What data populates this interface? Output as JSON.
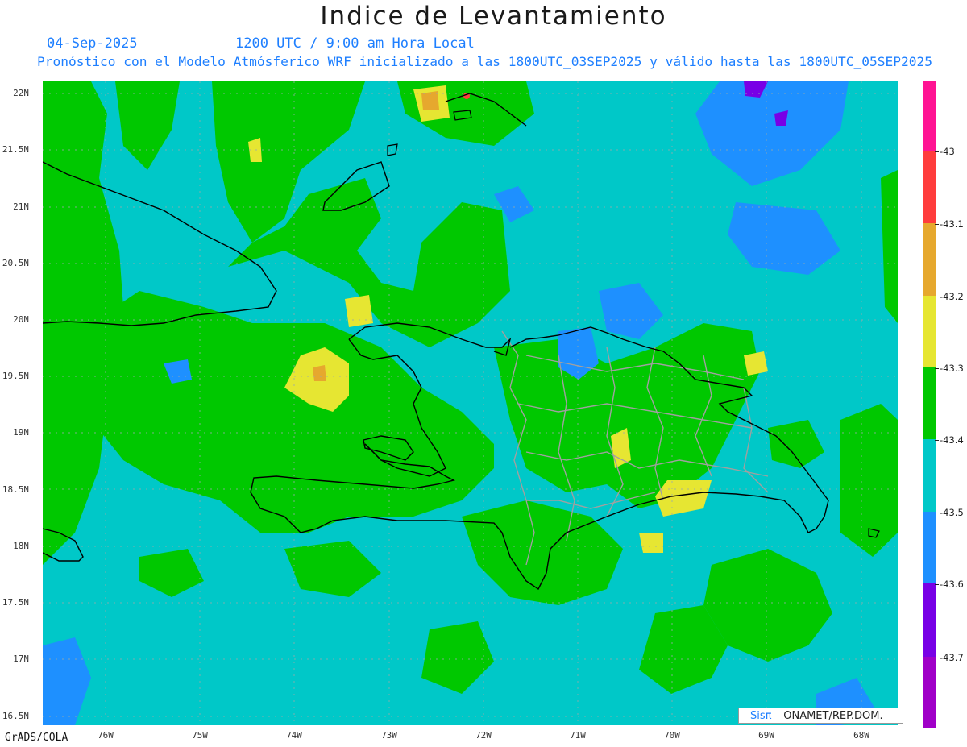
{
  "title": "Indice de Levantamiento",
  "date": "04-Sep-2025",
  "time": "1200 UTC / 9:00 am Hora Local",
  "description": "Pronóstico con el Modelo Atmósferico WRF inicializado a las 1800UTC_03SEP2025 y válido hasta las  1800UTC_05SEP2025",
  "lat_labels": [
    "22N",
    "21.5N",
    "21N",
    "20.5N",
    "20N",
    "19.5N",
    "19N",
    "18.5N",
    "18N",
    "17.5N",
    "17N",
    "16.5N"
  ],
  "lon_labels": [
    "76W",
    "75W",
    "74W",
    "73W",
    "72W",
    "71W",
    "70W",
    "69W",
    "68W"
  ],
  "footer_left": "GrADS/COLA",
  "credit": {
    "sis": "Sisπ",
    "rest": " – ONAMET/REP.DOM."
  },
  "colorbar": {
    "colors": [
      "#ff1493",
      "#ff3c3c",
      "#e6a82e",
      "#e6e632",
      "#00c800",
      "#00c8c8",
      "#1e90ff",
      "#7800e6",
      "#a000c8"
    ],
    "labels": [
      "-43",
      "-43.1",
      "-43.2",
      "-43.3",
      "-43.4",
      "-43.5",
      "-43.6",
      "-43.7"
    ]
  },
  "map_colors": {
    "green": "#00c800",
    "cyan": "#00c8c8",
    "blue": "#1e90ff",
    "yellow": "#e6e632",
    "orange": "#e6a82e",
    "red": "#ff3c3c",
    "purple": "#7800e6"
  }
}
